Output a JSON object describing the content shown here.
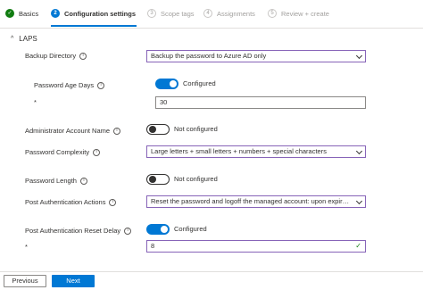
{
  "wizard": {
    "steps": [
      {
        "number": "✓",
        "label": "Basics"
      },
      {
        "number": "2",
        "label": "Configuration settings"
      },
      {
        "number": "3",
        "label": "Scope tags"
      },
      {
        "number": "4",
        "label": "Assignments"
      },
      {
        "number": "5",
        "label": "Review + create"
      }
    ]
  },
  "section": {
    "title": "LAPS",
    "chevron": "^"
  },
  "settings": {
    "backup_directory": {
      "label": "Backup Directory",
      "value": "Backup the password to Azure AD only"
    },
    "password_age_days": {
      "label": "Password Age Days",
      "toggle_label": "Configured",
      "required_mark": "*",
      "value": "30"
    },
    "admin_account_name": {
      "label": "Administrator Account Name",
      "toggle_label": "Not configured"
    },
    "password_complexity": {
      "label": "Password Complexity",
      "value": "Large letters + small letters + numbers + special characters"
    },
    "password_length": {
      "label": "Password Length",
      "toggle_label": "Not configured"
    },
    "post_auth_actions": {
      "label": "Post Authentication Actions",
      "value": "Reset the password and logoff the managed account: upon expiry of ..."
    },
    "post_auth_reset_delay": {
      "label": "Post Authentication Reset Delay",
      "toggle_label": "Configured",
      "required_mark": "*",
      "value": "8",
      "valid_mark": "✓"
    }
  },
  "info_glyph": "i",
  "footer": {
    "previous_label": "Previous",
    "next_label": "Next"
  }
}
